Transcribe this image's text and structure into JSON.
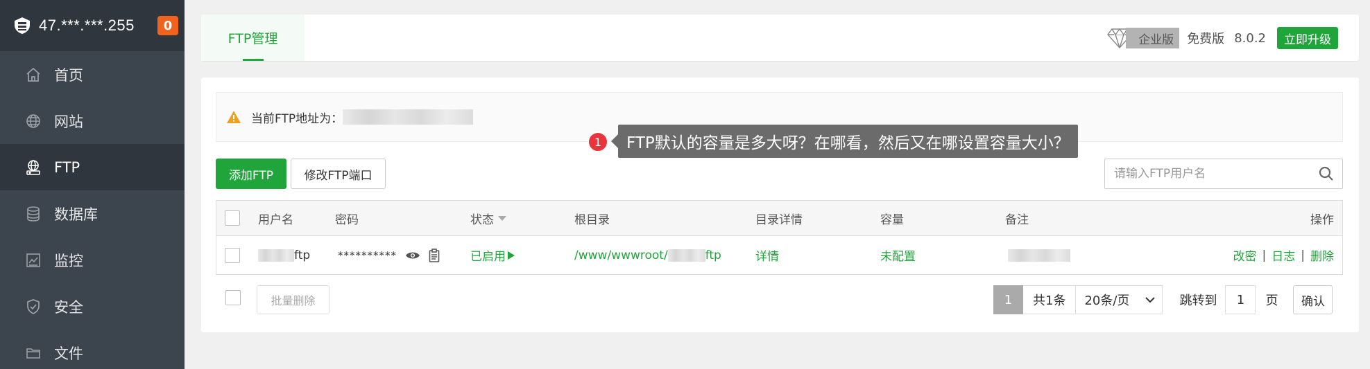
{
  "sidebar": {
    "ip": "47.***.***.255",
    "badge": "0",
    "items": [
      {
        "label": "首页",
        "icon": "home-icon"
      },
      {
        "label": "网站",
        "icon": "globe-icon"
      },
      {
        "label": "FTP",
        "icon": "ftp-icon"
      },
      {
        "label": "数据库",
        "icon": "database-icon"
      },
      {
        "label": "监控",
        "icon": "monitor-icon"
      },
      {
        "label": "安全",
        "icon": "shield-icon"
      },
      {
        "label": "文件",
        "icon": "folder-icon"
      }
    ],
    "active_index": 2
  },
  "topbar": {
    "tab": "FTP管理",
    "edition": "企业版",
    "free": "免费版",
    "version": "8.0.2",
    "upgrade": "立即升级"
  },
  "alert": {
    "label": "当前FTP地址为："
  },
  "toolbar": {
    "add": "添加FTP",
    "port": "修改FTP端口",
    "search_placeholder": "请输入FTP用户名"
  },
  "table": {
    "headers": {
      "user": "用户名",
      "password": "密码",
      "status": "状态",
      "root": "根目录",
      "detail": "目录详情",
      "capacity": "容量",
      "note": "备注",
      "ops": "操作"
    },
    "rows": [
      {
        "user_suffix": "ftp",
        "password": "**********",
        "status": "已启用",
        "root_prefix": "/www/wwwroot/",
        "root_suffix": "ftp",
        "detail": "详情",
        "capacity": "未配置",
        "ops": [
          "改密",
          "日志",
          "删除"
        ]
      }
    ]
  },
  "footer": {
    "batch_delete": "批量删除",
    "page": "1",
    "total": "共1条",
    "page_size": "20条/页",
    "jump_label": "跳转到",
    "jump_value": "1",
    "page_unit": "页",
    "confirm": "确认"
  },
  "annotation": {
    "number": "1",
    "text": "FTP默认的容量是多大呀？在哪看，然后又在哪设置容量大小？"
  },
  "colors": {
    "accent": "#20a53a",
    "sidebar_bg": "#3c444d",
    "badge": "#f0631d",
    "annotation_dot": "#e8353b"
  }
}
